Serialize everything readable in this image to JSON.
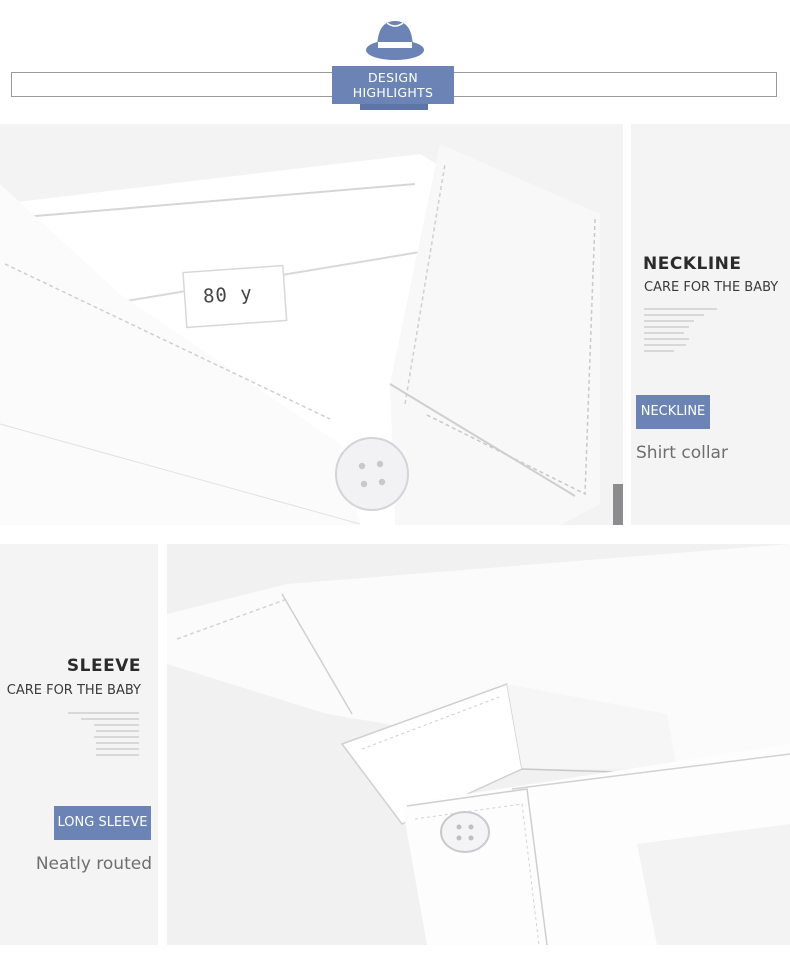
{
  "header": {
    "badge_line1": "DESIGN",
    "badge_line2": "HIGHLIGHTS",
    "icon": "hat-icon"
  },
  "colors": {
    "accent": "#6b84b5",
    "panel_bg": "#f4f4f4"
  },
  "neckline": {
    "title": "NECKLINE",
    "subtitle": "CARE FOR THE BABY",
    "tag": "NECKLINE",
    "description": "Shirt collar",
    "size_label": "80 y"
  },
  "sleeve": {
    "title": "SLEEVE",
    "subtitle": "CARE FOR THE BABY",
    "tag": "LONG SLEEVE",
    "description": "Neatly routed"
  }
}
